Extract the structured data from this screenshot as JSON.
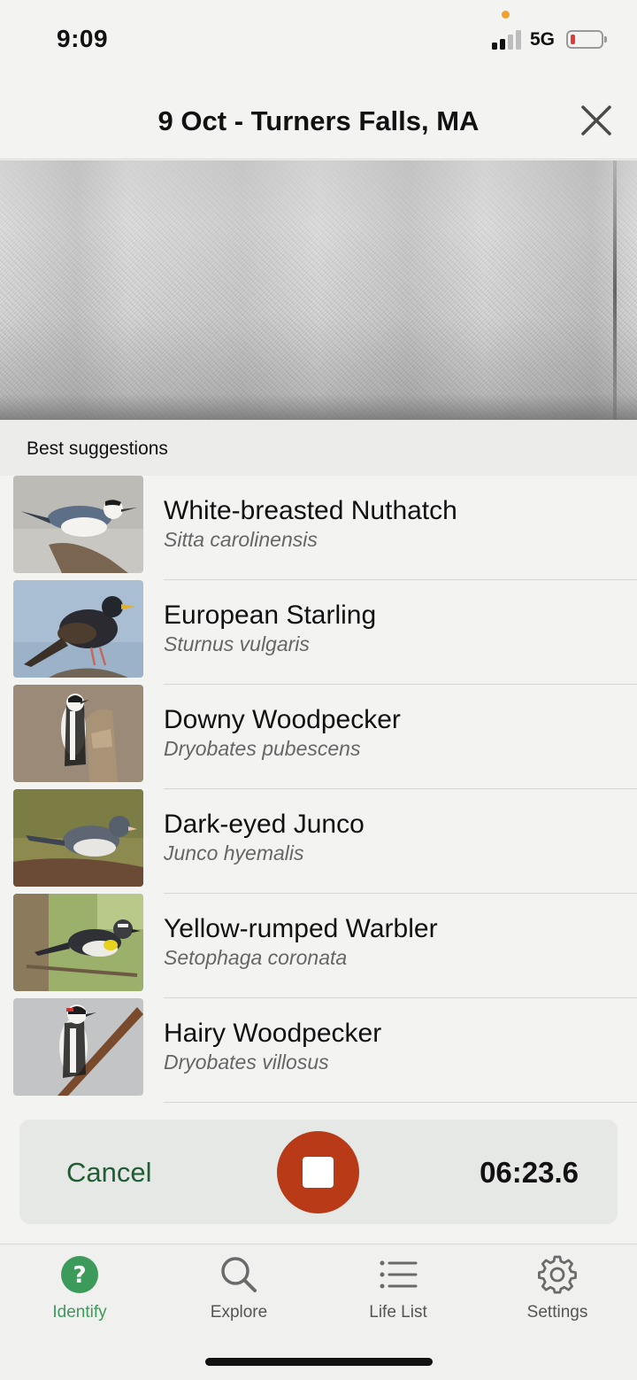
{
  "status_bar": {
    "time": "9:09",
    "network": "5G",
    "signal_bars_active": 2,
    "battery_level_percent": 8,
    "colors": {
      "battery_low": "#e53935",
      "privacy_dot": "#f0a030"
    }
  },
  "header": {
    "title": "9 Oct - Turners Falls, MA",
    "close_icon": "close-icon"
  },
  "results": {
    "section_label": "Best suggestions",
    "items": [
      {
        "common_name": "White-breasted Nuthatch",
        "scientific_name": "Sitta carolinensis",
        "image": "white-breasted-nuthatch-photo"
      },
      {
        "common_name": "European Starling",
        "scientific_name": "Sturnus vulgaris",
        "image": "european-starling-photo"
      },
      {
        "common_name": "Downy Woodpecker",
        "scientific_name": "Dryobates pubescens",
        "image": "downy-woodpecker-photo"
      },
      {
        "common_name": "Dark-eyed Junco",
        "scientific_name": "Junco hyemalis",
        "image": "dark-eyed-junco-photo"
      },
      {
        "common_name": "Yellow-rumped Warbler",
        "scientific_name": "Setophaga coronata",
        "image": "yellow-rumped-warbler-photo"
      },
      {
        "common_name": "Hairy Woodpecker",
        "scientific_name": "Dryobates villosus",
        "image": "hairy-woodpecker-photo"
      }
    ]
  },
  "recording": {
    "cancel_label": "Cancel",
    "elapsed": "06:23.6",
    "stop_icon": "stop-icon",
    "colors": {
      "stop_button": "#b83a17",
      "cancel_text": "#1f5e33"
    }
  },
  "tab_bar": {
    "tabs": [
      {
        "label": "Identify",
        "icon": "question-circle-icon",
        "active": true
      },
      {
        "label": "Explore",
        "icon": "search-icon",
        "active": false
      },
      {
        "label": "Life List",
        "icon": "list-icon",
        "active": false
      },
      {
        "label": "Settings",
        "icon": "gear-icon",
        "active": false
      }
    ],
    "colors": {
      "active": "#3c9a5a",
      "inactive": "#555555"
    }
  }
}
